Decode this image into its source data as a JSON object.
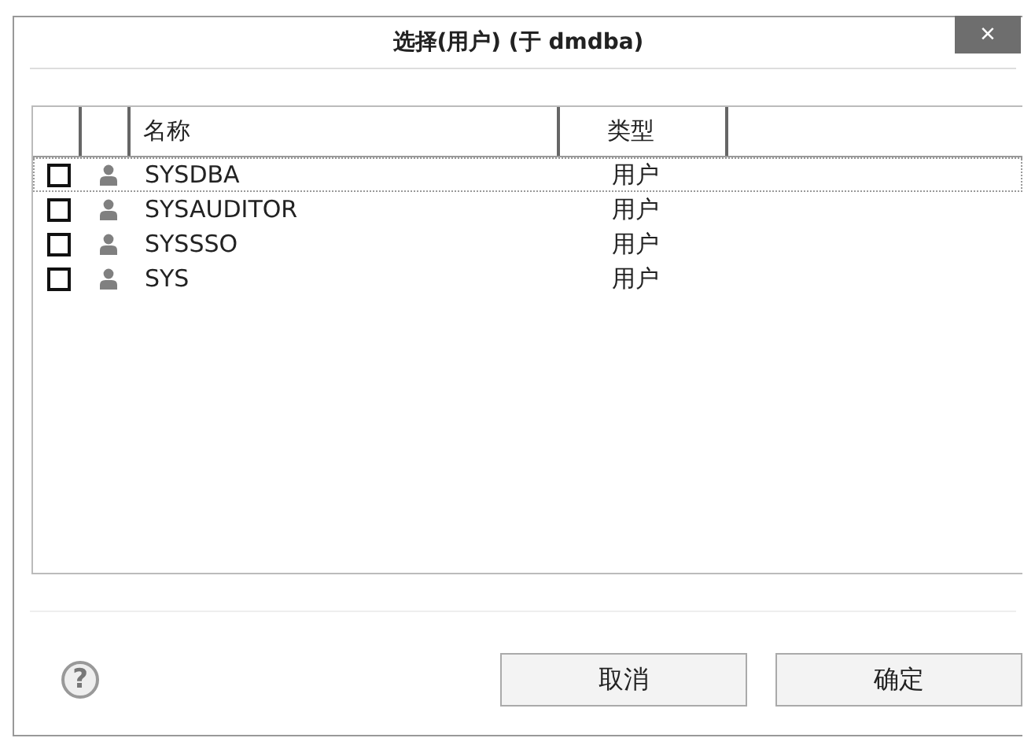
{
  "window": {
    "title": "选择(用户) (于 dmdba)",
    "close": "×"
  },
  "table": {
    "columns": [
      "名称",
      "类型"
    ],
    "rows": [
      {
        "checked": false,
        "focused": true,
        "name": "SYSDBA",
        "type": "用户"
      },
      {
        "checked": false,
        "focused": false,
        "name": "SYSAUDITOR",
        "type": "用户"
      },
      {
        "checked": false,
        "focused": false,
        "name": "SYSSSO",
        "type": "用户"
      },
      {
        "checked": false,
        "focused": false,
        "name": "SYS",
        "type": "用户"
      }
    ]
  },
  "help": "?",
  "buttons": [
    "取消",
    "确定"
  ]
}
